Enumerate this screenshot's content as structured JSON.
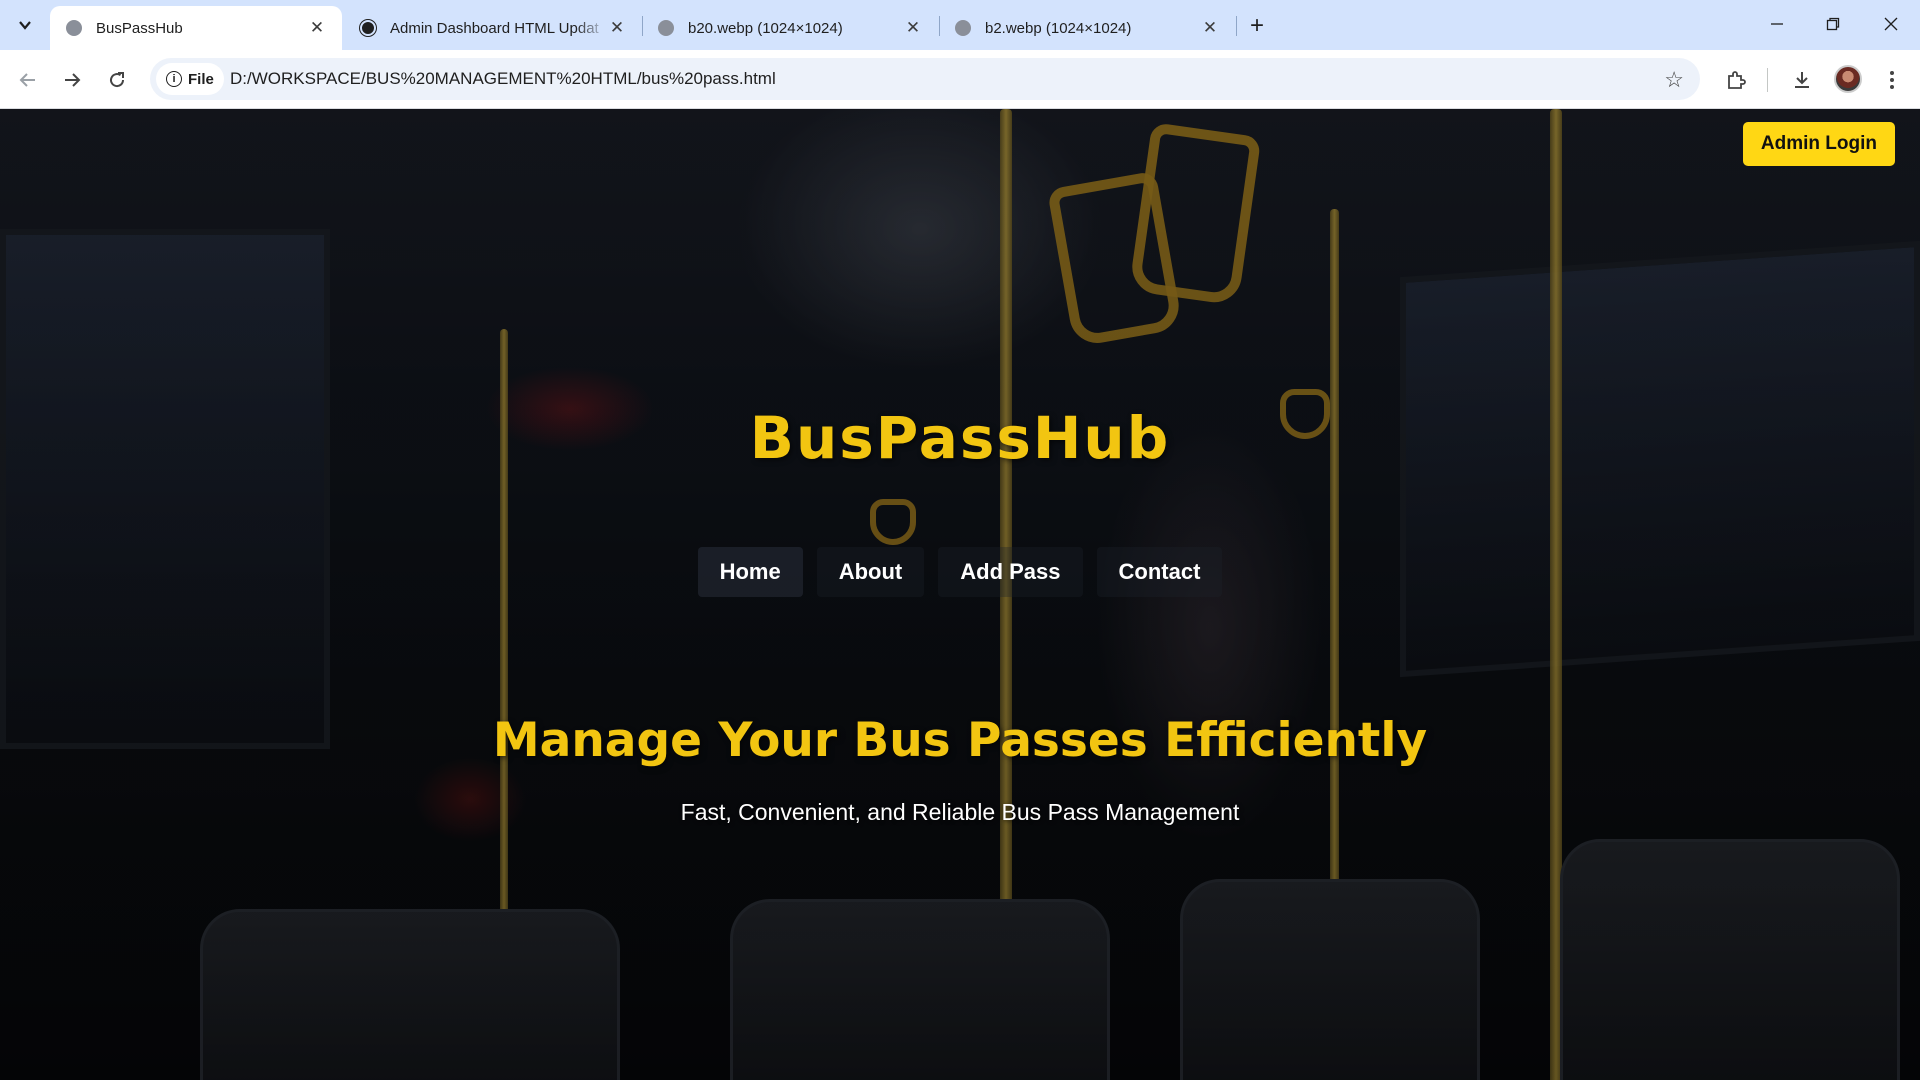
{
  "browser": {
    "tabs": [
      {
        "title": "BusPassHub",
        "active": true,
        "favicon": "globe-icon"
      },
      {
        "title": "Admin Dashboard HTML Updat",
        "active": false,
        "favicon": "openai-icon"
      },
      {
        "title": "b20.webp (1024×1024)",
        "active": false,
        "favicon": "globe-icon"
      },
      {
        "title": "b2.webp (1024×1024)",
        "active": false,
        "favicon": "globe-icon"
      }
    ],
    "address": {
      "scheme_chip": "File",
      "url": "D:/WORKSPACE/BUS%20MANAGEMENT%20HTML/bus%20pass.html"
    }
  },
  "page": {
    "admin_login_label": "Admin Login",
    "brand": "BusPassHub",
    "nav": [
      {
        "label": "Home",
        "active": true
      },
      {
        "label": "About",
        "active": false
      },
      {
        "label": "Add Pass",
        "active": false
      },
      {
        "label": "Contact",
        "active": false
      }
    ],
    "hero": {
      "title": "Manage Your Bus Passes Efficiently",
      "subtitle": "Fast, Convenient, and Reliable Bus Pass Management"
    }
  },
  "colors": {
    "accent_yellow": "#f2c511",
    "button_yellow": "#ffd714",
    "tabstrip": "#d3e3fd"
  }
}
